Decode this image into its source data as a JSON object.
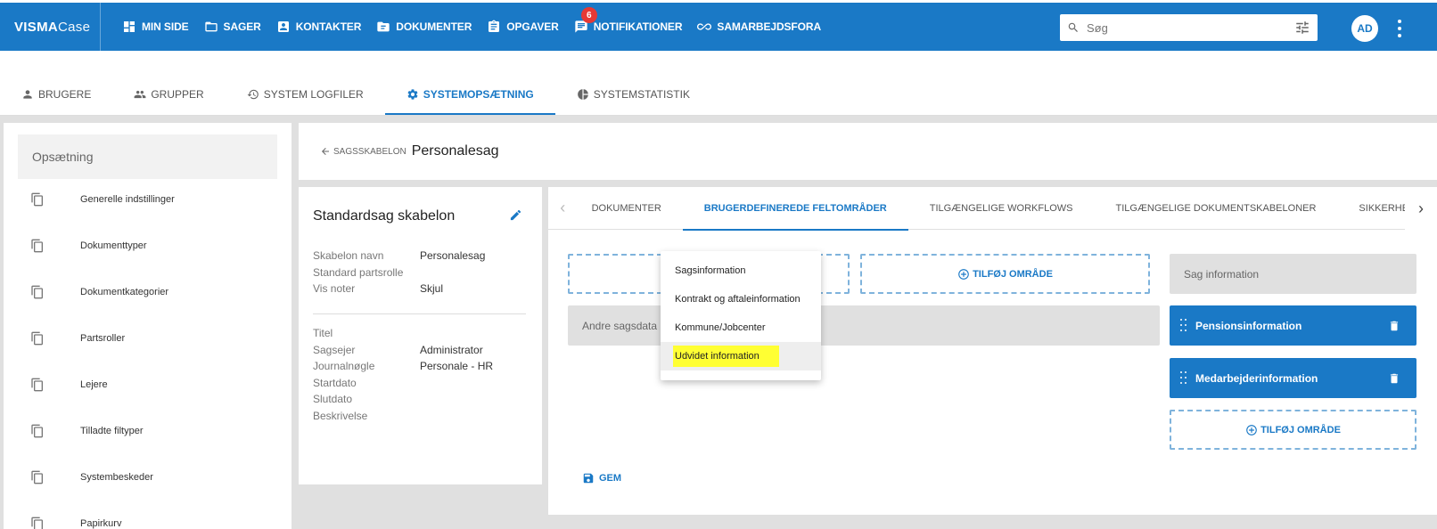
{
  "brand": {
    "name_bold": "VISMA",
    "name_light": "Case"
  },
  "topnav": {
    "items": [
      {
        "label": "MIN SIDE",
        "icon": "dashboard-icon"
      },
      {
        "label": "SAGER",
        "icon": "folder-icon"
      },
      {
        "label": "KONTAKTER",
        "icon": "contact-icon"
      },
      {
        "label": "DOKUMENTER",
        "icon": "document-folder-icon"
      },
      {
        "label": "OPGAVER",
        "icon": "clipboard-icon"
      },
      {
        "label": "NOTIFIKATIONER",
        "icon": "chat-icon",
        "badge": "6"
      },
      {
        "label": "SAMARBEJDSFORA",
        "icon": "infinity-icon"
      }
    ],
    "search_placeholder": "Søg",
    "avatar": "AD"
  },
  "subnav": {
    "tabs": [
      {
        "label": "BRUGERE",
        "icon": "person-icon"
      },
      {
        "label": "GRUPPER",
        "icon": "group-icon"
      },
      {
        "label": "SYSTEM LOGFILER",
        "icon": "history-icon"
      },
      {
        "label": "SYSTEMOPSÆTNING",
        "icon": "gear-icon",
        "active": true
      },
      {
        "label": "SYSTEMSTATISTIK",
        "icon": "pie-chart-icon"
      }
    ]
  },
  "sidebar": {
    "title": "Opsætning",
    "items": [
      "Generelle indstillinger",
      "Dokumenttyper",
      "Dokumentkategorier",
      "Partsroller",
      "Lejere",
      "Tilladte filtyper",
      "Systembeskeder",
      "Papirkurv"
    ]
  },
  "breadcrumb": {
    "back_label": "SAGSSKABELON",
    "title": "Personalesag"
  },
  "info": {
    "title": "Standardsag skabelon",
    "rows1": [
      {
        "k": "Skabelon navn",
        "v": "Personalesag"
      },
      {
        "k": "Standard partsrolle",
        "v": ""
      },
      {
        "k": "Vis noter",
        "v": "Skjul"
      }
    ],
    "rows2": [
      {
        "k": "Titel",
        "v": ""
      },
      {
        "k": "Sagsejer",
        "v": "Administrator"
      },
      {
        "k": "Journalnøgle",
        "v": "Personale - HR"
      },
      {
        "k": "Startdato",
        "v": ""
      },
      {
        "k": "Slutdato",
        "v": ""
      },
      {
        "k": "Beskrivelse",
        "v": ""
      }
    ]
  },
  "tabs": {
    "items": [
      "DOKUMENTER",
      "BRUGERDEFINEREDE FELTOMRÅDER",
      "TILGÆNGELIGE WORKFLOWS",
      "TILGÆNGELIGE DOKUMENTSKABELONER",
      "SIKKERHED"
    ],
    "active_index": 1
  },
  "areas": {
    "add_label": "TILFØJ OMRÅDE",
    "other_case_data": "Andre sagsdata",
    "case_info": "Sag information",
    "fields": [
      "Pensionsinformation",
      "Medarbejderinformation"
    ],
    "save_label": "GEM"
  },
  "menu": {
    "items": [
      "Sagsinformation",
      "Kontrakt og aftaleinformation",
      "Kommune/Jobcenter",
      "Udvidet information"
    ],
    "highlighted_index": 3
  },
  "colors": {
    "primary": "#1a79c6",
    "highlight": "#ffff33",
    "badge": "#e53935"
  }
}
